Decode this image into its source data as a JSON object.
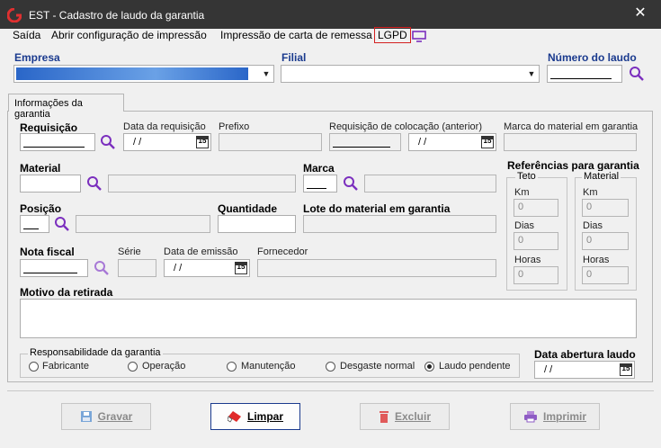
{
  "window": {
    "title": "EST - Cadastro de laudo da garantia",
    "close_glyph": "✕"
  },
  "menu": {
    "saida": "Saída",
    "config": "Abrir configuração de impressão",
    "carta": "Impressão de carta de remessa",
    "lgpd": "LGPD"
  },
  "header": {
    "empresa_label": "Empresa",
    "filial_label": "Filial",
    "numero_label": "Número do laudo"
  },
  "tab": {
    "label": "Informações da garantia"
  },
  "fields": {
    "requisicao": "Requisição",
    "data_requisicao": "Data da requisição",
    "prefixo": "Prefixo",
    "req_colocacao": "Requisição de colocação (anterior)",
    "marca_material": "Marca do material em garantia",
    "material": "Material",
    "marca": "Marca",
    "posicao": "Posição",
    "quantidade": "Quantidade",
    "lote": "Lote do material em garantia",
    "nota_fiscal": "Nota fiscal",
    "serie": "Série",
    "data_emissao": "Data de emissão",
    "fornecedor": "Fornecedor",
    "motivo": "Motivo da retirada",
    "date_placeholder": "/ /",
    "cal_glyph": "15"
  },
  "referencias": {
    "title": "Referências para garantia",
    "teto": "Teto",
    "material": "Material",
    "km": "Km",
    "dias": "Dias",
    "horas": "Horas",
    "zero": "0"
  },
  "responsabilidade": {
    "title": "Responsabilidade da garantia",
    "options": [
      "Fabricante",
      "Operação",
      "Manutenção",
      "Desgaste normal",
      "Laudo pendente"
    ],
    "selected": "Laudo pendente"
  },
  "data_abertura": {
    "label": "Data abertura laudo",
    "value": "/ /"
  },
  "buttons": {
    "gravar": "Gravar",
    "limpar": "Limpar",
    "excluir": "Excluir",
    "imprimir": "Imprimir"
  },
  "colors": {
    "accent_blue": "#1a3a8e",
    "search_purple": "#7b2fbe",
    "lgpd_red": "#d32020"
  }
}
